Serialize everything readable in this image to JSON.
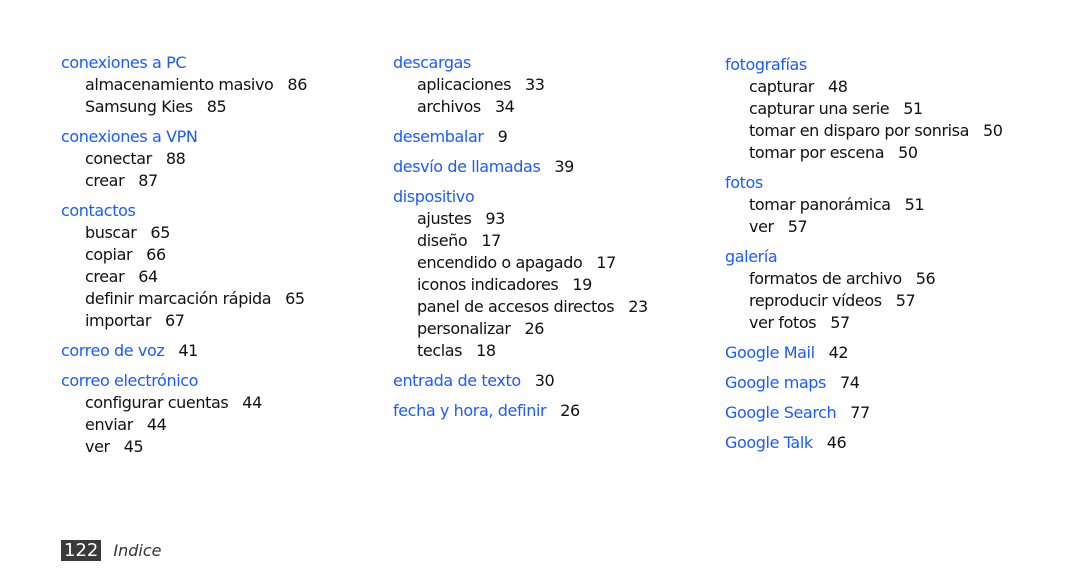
{
  "accent_color": "#1a5cff",
  "columns": [
    {
      "entries": [
        {
          "term": "conexiones a PC",
          "page": "",
          "subs": [
            {
              "term": "almacenamiento masivo",
              "page": "86"
            },
            {
              "term": "Samsung Kies",
              "page": "85"
            }
          ]
        },
        {
          "term": "conexiones a VPN",
          "page": "",
          "subs": [
            {
              "term": "conectar",
              "page": "88"
            },
            {
              "term": "crear",
              "page": "87"
            }
          ]
        },
        {
          "term": "contactos",
          "page": "",
          "subs": [
            {
              "term": "buscar",
              "page": "65"
            },
            {
              "term": "copiar",
              "page": "66"
            },
            {
              "term": "crear",
              "page": "64"
            },
            {
              "term": "definir marcación rápida",
              "page": "65"
            },
            {
              "term": "importar",
              "page": "67"
            }
          ]
        },
        {
          "term": "correo de voz",
          "page": "41",
          "subs": []
        },
        {
          "term": "correo electrónico",
          "page": "",
          "subs": [
            {
              "term": "configurar cuentas",
              "page": "44"
            },
            {
              "term": "enviar",
              "page": "44"
            },
            {
              "term": "ver",
              "page": "45"
            }
          ]
        }
      ]
    },
    {
      "entries": [
        {
          "term": "descargas",
          "page": "",
          "subs": [
            {
              "term": "aplicaciones",
              "page": "33"
            },
            {
              "term": "archivos",
              "page": "34"
            }
          ]
        },
        {
          "term": "desembalar",
          "page": "9",
          "subs": []
        },
        {
          "term": "desvío de llamadas",
          "page": "39",
          "subs": []
        },
        {
          "term": "dispositivo",
          "page": "",
          "subs": [
            {
              "term": "ajustes",
              "page": "93"
            },
            {
              "term": "diseño",
              "page": "17"
            },
            {
              "term": "encendido o apagado",
              "page": "17"
            },
            {
              "term": "iconos indicadores",
              "page": "19"
            },
            {
              "term": "panel de accesos directos",
              "page": "23"
            },
            {
              "term": "personalizar",
              "page": "26"
            },
            {
              "term": "teclas",
              "page": "18"
            }
          ]
        },
        {
          "term": "entrada de texto",
          "page": "30",
          "subs": []
        },
        {
          "term": "fecha y hora, definir",
          "page": "26",
          "subs": []
        }
      ]
    },
    {
      "entries": [
        {
          "term": "fotografías",
          "page": "",
          "subs": [
            {
              "term": "capturar",
              "page": "48"
            },
            {
              "term": "capturar una serie",
              "page": "51"
            },
            {
              "term": "tomar en disparo por sonrisa",
              "page": "50"
            },
            {
              "term": "tomar por escena",
              "page": "50"
            }
          ]
        },
        {
          "term": "fotos",
          "page": "",
          "subs": [
            {
              "term": "tomar panorámica",
              "page": "51"
            },
            {
              "term": "ver",
              "page": "57"
            }
          ]
        },
        {
          "term": "galería",
          "page": "",
          "subs": [
            {
              "term": "formatos de archivo",
              "page": "56"
            },
            {
              "term": "reproducir vídeos",
              "page": "57"
            },
            {
              "term": "ver fotos",
              "page": "57"
            }
          ]
        },
        {
          "term": "Google Mail",
          "page": "42",
          "subs": []
        },
        {
          "term": "Google maps",
          "page": "74",
          "subs": []
        },
        {
          "term": "Google Search",
          "page": "77",
          "subs": []
        },
        {
          "term": "Google Talk",
          "page": "46",
          "subs": []
        }
      ]
    }
  ],
  "footer": {
    "page_number": "122",
    "section": "Indice"
  }
}
